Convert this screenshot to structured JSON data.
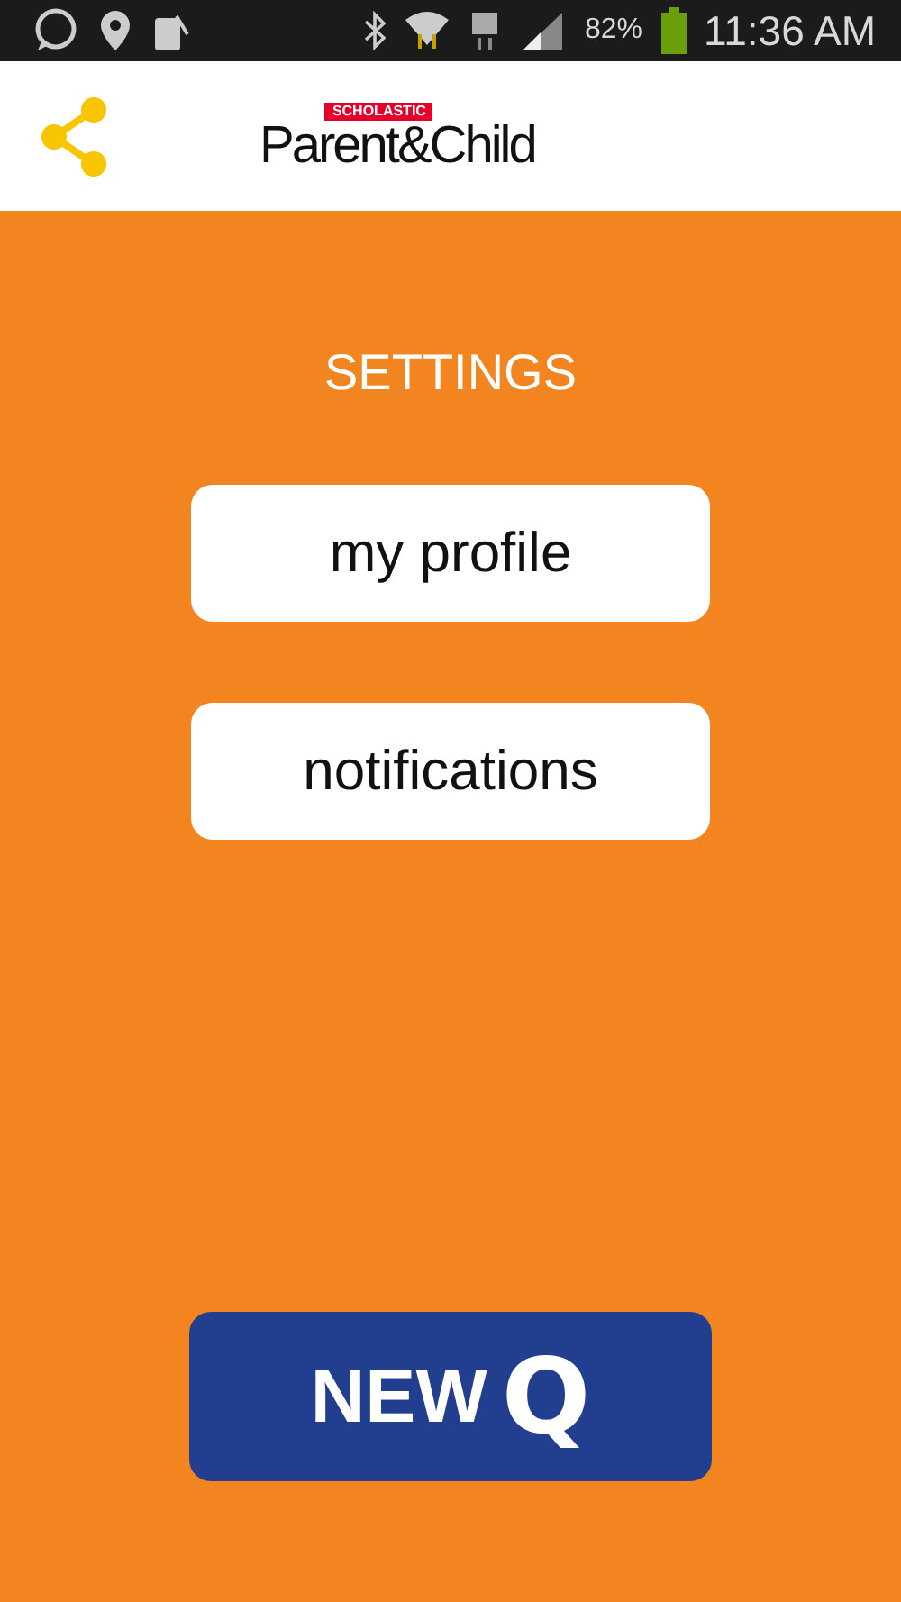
{
  "status_bar": {
    "battery": "82%",
    "time": "11:36 AM"
  },
  "header": {
    "logo": {
      "brand": "SCHOLASTIC",
      "name": "Parent&Child"
    }
  },
  "title": "SETTINGS",
  "menu": [
    "my profile",
    "notifications"
  ],
  "new_button": {
    "word": "NEW",
    "letter": "Q"
  }
}
